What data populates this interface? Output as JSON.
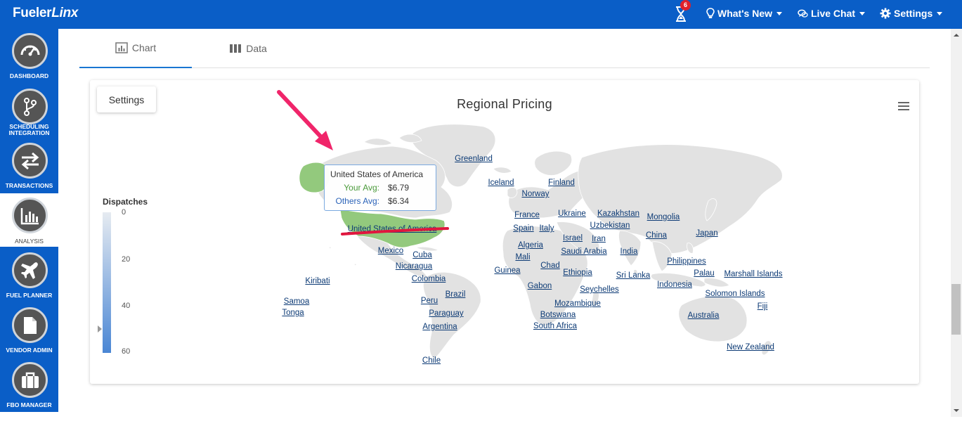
{
  "app": {
    "logo_part1": "Fueler",
    "logo_part2": "Linx"
  },
  "topbar": {
    "notification_count": "6",
    "whats_new": "What's New",
    "live_chat": "Live Chat",
    "settings": "Settings"
  },
  "sidebar": {
    "items": [
      {
        "label": "DASHBOARD",
        "icon": "dashboard-gauge-icon"
      },
      {
        "label": "SCHEDULING INTEGRATION",
        "icon": "branch-icon"
      },
      {
        "label": "TRANSACTIONS",
        "icon": "swap-arrows-icon"
      },
      {
        "label": "ANALYSIS",
        "icon": "bar-chart-icon",
        "active": true
      },
      {
        "label": "FUEL PLANNER",
        "icon": "airplane-icon"
      },
      {
        "label": "VENDOR ADMIN",
        "icon": "document-icon"
      },
      {
        "label": "FBO MANAGER",
        "icon": "briefcase-icon"
      }
    ]
  },
  "tabs": [
    {
      "label": "Chart",
      "active": true
    },
    {
      "label": "Data",
      "active": false
    }
  ],
  "card": {
    "settings_button": "Settings"
  },
  "chart_data": {
    "type": "map",
    "title": "Regional Pricing",
    "legend": {
      "title": "Dispatches",
      "ticks": [
        "0",
        "20",
        "40",
        "60"
      ],
      "min": 0,
      "max": 60,
      "color_low": "#e6ebf1",
      "color_high": "#4a86d4"
    },
    "countries": [
      "Greenland",
      "Iceland",
      "Finland",
      "Norway",
      "France",
      "Ukraine",
      "Kazakhstan",
      "Mongolia",
      "Spain",
      "Italy",
      "Uzbekistan",
      "Japan",
      "China",
      "Israel",
      "Iran",
      "Algeria",
      "Saudi Arabia",
      "India",
      "Mali",
      "Chad",
      "Philippines",
      "Guinea",
      "Ethiopia",
      "Sri Lanka",
      "Palau",
      "Marshall Islands",
      "Gabon",
      "Seychelles",
      "Indonesia",
      "Solomon Islands",
      "Mozambique",
      "Fiji",
      "Botswana",
      "Australia",
      "South Africa",
      "New Zealand",
      "United States of America",
      "Mexico",
      "Cuba",
      "Nicaragua",
      "Colombia",
      "Kiribati",
      "Brazil",
      "Samoa",
      "Peru",
      "Tonga",
      "Paraguay",
      "Argentina",
      "Chile"
    ],
    "tooltip": {
      "country": "United States of America",
      "rows": [
        {
          "label": "Your Avg:",
          "value": "$6.79",
          "color": "#4a9a3a"
        },
        {
          "label": "Others Avg:",
          "value": "$6.34",
          "color": "#2a62b8"
        }
      ]
    },
    "highlight_color": "#93c97d",
    "base_color": "#e2e2e2"
  },
  "colors": {
    "brand": "#0a5ec7",
    "annotation_arrow": "#f0256a",
    "annotation_underline": "#e0163e"
  }
}
